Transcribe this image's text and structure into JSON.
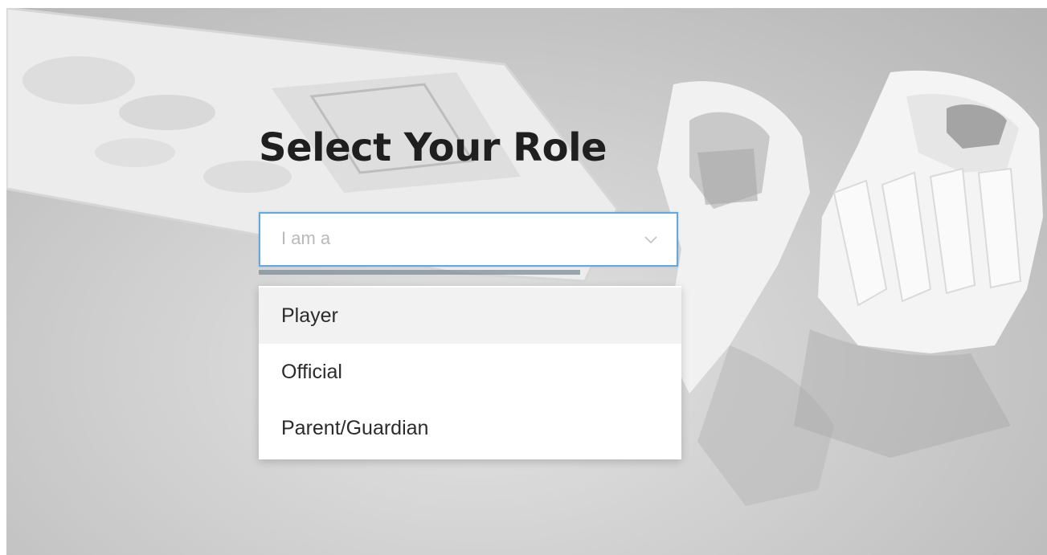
{
  "page": {
    "title": "Select Your Role"
  },
  "role_select": {
    "placeholder": "I am a",
    "icon": "chevron-down-icon",
    "focus_color": "#6aa7d8"
  },
  "role_menu": {
    "options": [
      {
        "label": "Player",
        "highlighted": true
      },
      {
        "label": "Official",
        "highlighted": false
      },
      {
        "label": "Parent/Guardian",
        "highlighted": false
      }
    ]
  },
  "background": {
    "image": "cricket-bat-and-gloves-photo"
  }
}
